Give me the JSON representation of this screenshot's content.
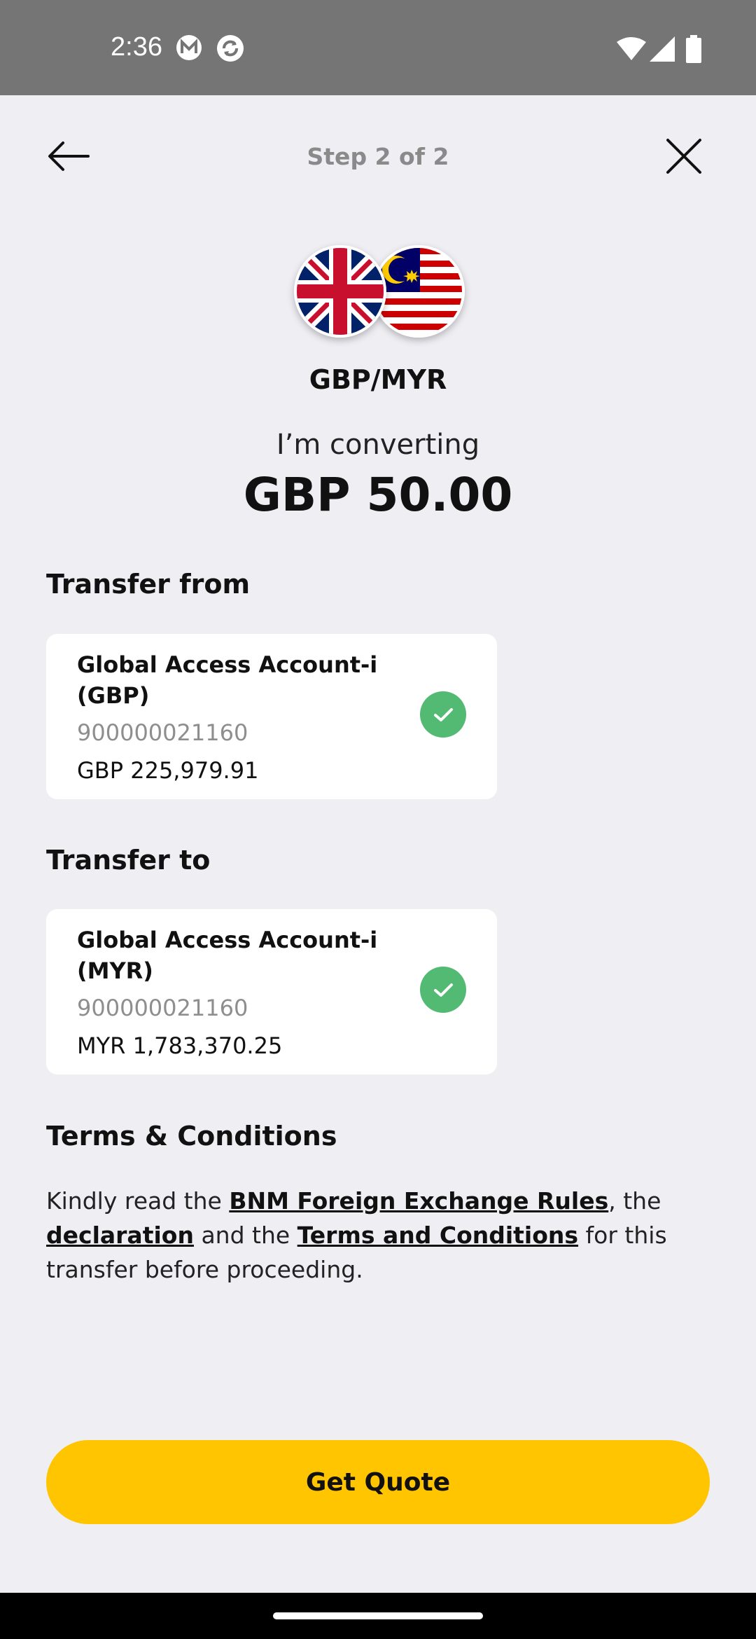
{
  "status_bar": {
    "time": "2:36"
  },
  "header": {
    "step": "Step 2 of 2"
  },
  "currency_pair": "GBP/MYR",
  "conversion": {
    "label": "I’m converting",
    "amount": "GBP 50.00"
  },
  "transfer_from": {
    "title": "Transfer from",
    "account_name": "Global Access Account-i (GBP)",
    "account_number": "900000021160",
    "balance": "GBP 225,979.91"
  },
  "transfer_to": {
    "title": "Transfer to",
    "account_name": "Global Access Account-i (MYR)",
    "account_number": "900000021160",
    "balance": "MYR 1,783,370.25"
  },
  "terms": {
    "title": "Terms & Conditions",
    "part1": "Kindly read the ",
    "link1": "BNM Foreign Exchange Rules",
    "part2": ", the ",
    "link2": "declaration",
    "part3": " and the ",
    "link3": "Terms and Conditions",
    "part4": " for this transfer before proceeding."
  },
  "button": {
    "get_quote": "Get Quote"
  },
  "icons": {
    "back": "arrow-left-icon",
    "close": "close-icon",
    "selected": "check-circle-icon"
  },
  "colors": {
    "accent": "#FFC500",
    "check": "#52BA72",
    "background": "#EFEEF3"
  }
}
